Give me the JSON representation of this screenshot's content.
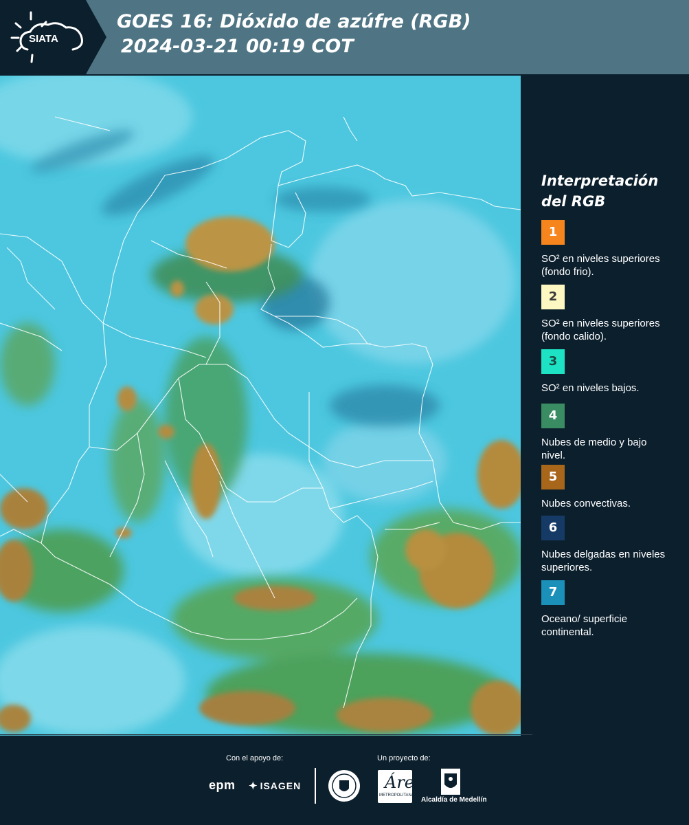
{
  "header": {
    "logo_text": "SIATA",
    "title_line1": "GOES 16: Dióxido de azúfre (RGB)",
    "title_line2": "2024-03-21 00:19 COT"
  },
  "legend": {
    "title_line1": "Interpretación",
    "title_line2": "del RGB",
    "items": [
      {
        "number": "1",
        "color": "#f7851e",
        "text_color": "#ffffff",
        "label": "SO² en niveles superiores (fondo frio)."
      },
      {
        "number": "2",
        "color": "#fdf7c2",
        "text_color": "#3a3a3a",
        "label": "SO² en niveles superiores (fondo calido)."
      },
      {
        "number": "3",
        "color": "#1de3c4",
        "text_color": "#1a4a44",
        "label": "SO² en niveles bajos."
      },
      {
        "number": "4",
        "color": "#3a8c62",
        "text_color": "#ffffff",
        "label": "Nubes de medio y bajo nivel."
      },
      {
        "number": "5",
        "color": "#a8661b",
        "text_color": "#ffffff",
        "label": "Nubes convectivas."
      },
      {
        "number": "6",
        "color": "#163a66",
        "text_color": "#ffffff",
        "label": "Nubes delgadas en niveles superiores."
      },
      {
        "number": "7",
        "color": "#1b90b8",
        "text_color": "#ffffff",
        "label": "Oceano/ superficie continental."
      }
    ]
  },
  "footer": {
    "support_label": "Con el apoyo de:",
    "project_label": "Un proyecto de:",
    "sponsor_epm": "epm",
    "sponsor_isagen": "ISAGEN",
    "partner_area_mark": "Área",
    "partner_area_caption": "METROPOLITANA",
    "partner_alcaldia": "Alcaldía de Medellín"
  },
  "colors": {
    "header_bg": "#4f7584",
    "page_bg": "#0c1f2d",
    "map_base": "#4cc7df",
    "convective": "#b38a3c",
    "mid_low_clouds": "#3f9d55"
  }
}
